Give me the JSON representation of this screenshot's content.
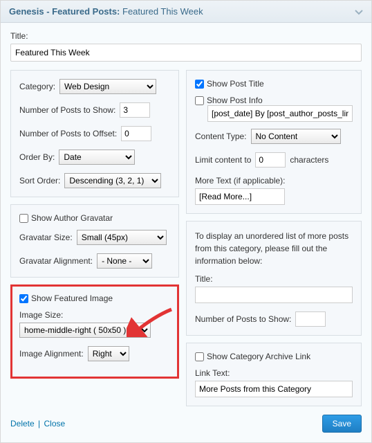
{
  "header": {
    "prefix": "Genesis - Featured Posts:",
    "suffix": "Featured This Week"
  },
  "title": {
    "label": "Title:",
    "value": "Featured This Week"
  },
  "query_panel": {
    "category_label": "Category:",
    "category_value": "Web Design",
    "num_posts_label": "Number of Posts to Show:",
    "num_posts_value": "3",
    "offset_label": "Number of Posts to Offset:",
    "offset_value": "0",
    "orderby_label": "Order By:",
    "orderby_value": "Date",
    "sort_label": "Sort Order:",
    "sort_value": "Descending (3, 2, 1)"
  },
  "gravatar_panel": {
    "show_label": "Show Author Gravatar",
    "show_checked": false,
    "size_label": "Gravatar Size:",
    "size_value": "Small (45px)",
    "align_label": "Gravatar Alignment:",
    "align_value": "- None -"
  },
  "image_panel": {
    "show_label": "Show Featured Image",
    "show_checked": true,
    "size_label": "Image Size:",
    "size_value": "home-middle-right ( 50x50 )",
    "align_label": "Image Alignment:",
    "align_value": "Right"
  },
  "content_panel": {
    "show_title_label": "Show Post Title",
    "show_title_checked": true,
    "show_info_label": "Show Post Info",
    "show_info_checked": false,
    "info_value": "[post_date] By [post_author_posts_link]",
    "content_type_label": "Content Type:",
    "content_type_value": "No Content",
    "limit_prefix": "Limit content to",
    "limit_value": "0",
    "limit_suffix": "characters",
    "more_text_label": "More Text (if applicable):",
    "more_text_value": "[Read More...]"
  },
  "extra_posts_panel": {
    "intro": "To display an unordered list of more posts from this category, please fill out the information below:",
    "title_label": "Title:",
    "title_value": "",
    "num_label": "Number of Posts to Show:",
    "num_value": ""
  },
  "archive_panel": {
    "show_label": "Show Category Archive Link",
    "show_checked": false,
    "link_text_label": "Link Text:",
    "link_text_value": "More Posts from this Category"
  },
  "footer": {
    "delete": "Delete",
    "close": "Close",
    "save": "Save"
  }
}
